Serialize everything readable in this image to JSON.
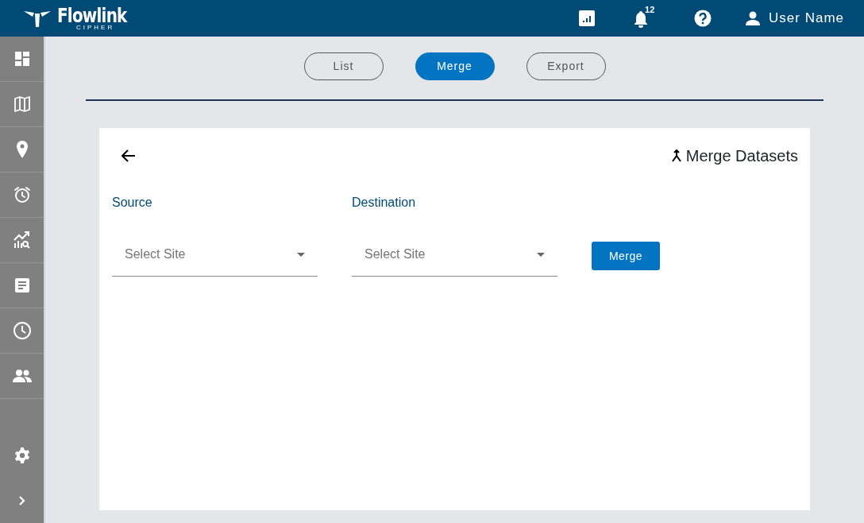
{
  "header": {
    "logo_text": "Flowlink",
    "logo_subtext": "CIPHER",
    "notification_count": "12",
    "user_name": "User Name"
  },
  "sidebar": {
    "items": [
      {
        "kind": "dashboard"
      },
      {
        "kind": "map"
      },
      {
        "kind": "pin"
      },
      {
        "kind": "alarm"
      },
      {
        "kind": "analytics"
      },
      {
        "kind": "report"
      },
      {
        "kind": "clock"
      },
      {
        "kind": "users"
      }
    ],
    "bottom": [
      {
        "kind": "settings"
      },
      {
        "kind": "expand"
      }
    ]
  },
  "tabs": [
    {
      "label": "List",
      "selected": false
    },
    {
      "label": "Merge",
      "selected": true
    },
    {
      "label": "Export",
      "selected": false
    }
  ],
  "card": {
    "title": "Merge Datasets",
    "fields": [
      {
        "label": "Source",
        "placeholder": "Select Site"
      },
      {
        "label": "Destination",
        "placeholder": "Select Site"
      }
    ],
    "button": "Merge"
  }
}
